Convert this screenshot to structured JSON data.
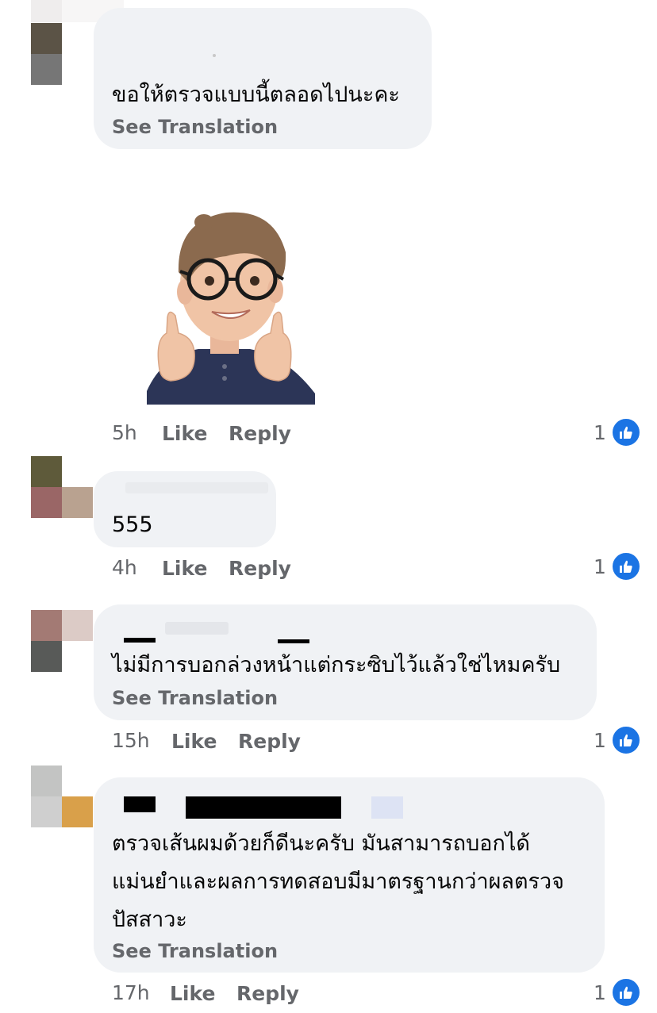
{
  "comments": [
    {
      "text_lines": [
        "ขอให้ตรวจแบบนี้ตลอดไปนะคะ"
      ],
      "see_translation": "See Translation",
      "has_sticker": true,
      "time": "5h",
      "like": "Like",
      "reply": "Reply",
      "reactions": "1"
    },
    {
      "text_lines": [
        "555"
      ],
      "time": "4h",
      "like": "Like",
      "reply": "Reply",
      "reactions": "1"
    },
    {
      "text_lines": [
        "ไม่มีการบอกล่วงหน้าแต่กระซิบไว้แล้วใช่ไหมครับ"
      ],
      "see_translation": "See Translation",
      "time": "15h",
      "like": "Like",
      "reply": "Reply",
      "reactions": "1"
    },
    {
      "text_lines": [
        "ตรวจเส้นผมด้วยก็ดีนะครับ มันสามารถบอกได้",
        "แม่นยำและผลการทดสอบมีมาตรฐานกว่าผลตรวจ",
        "ปัสสาวะ"
      ],
      "see_translation": "See Translation",
      "time": "17h",
      "like": "Like",
      "reply": "Reply",
      "reactions": "1"
    }
  ],
  "colors": {
    "like_blue": "#1b74e4",
    "bubble": "#f0f2f5",
    "muted": "#65676b"
  },
  "icons": {
    "reaction": "thumbs-up-icon",
    "sticker": "memoji-thumbs-up-sticker"
  }
}
